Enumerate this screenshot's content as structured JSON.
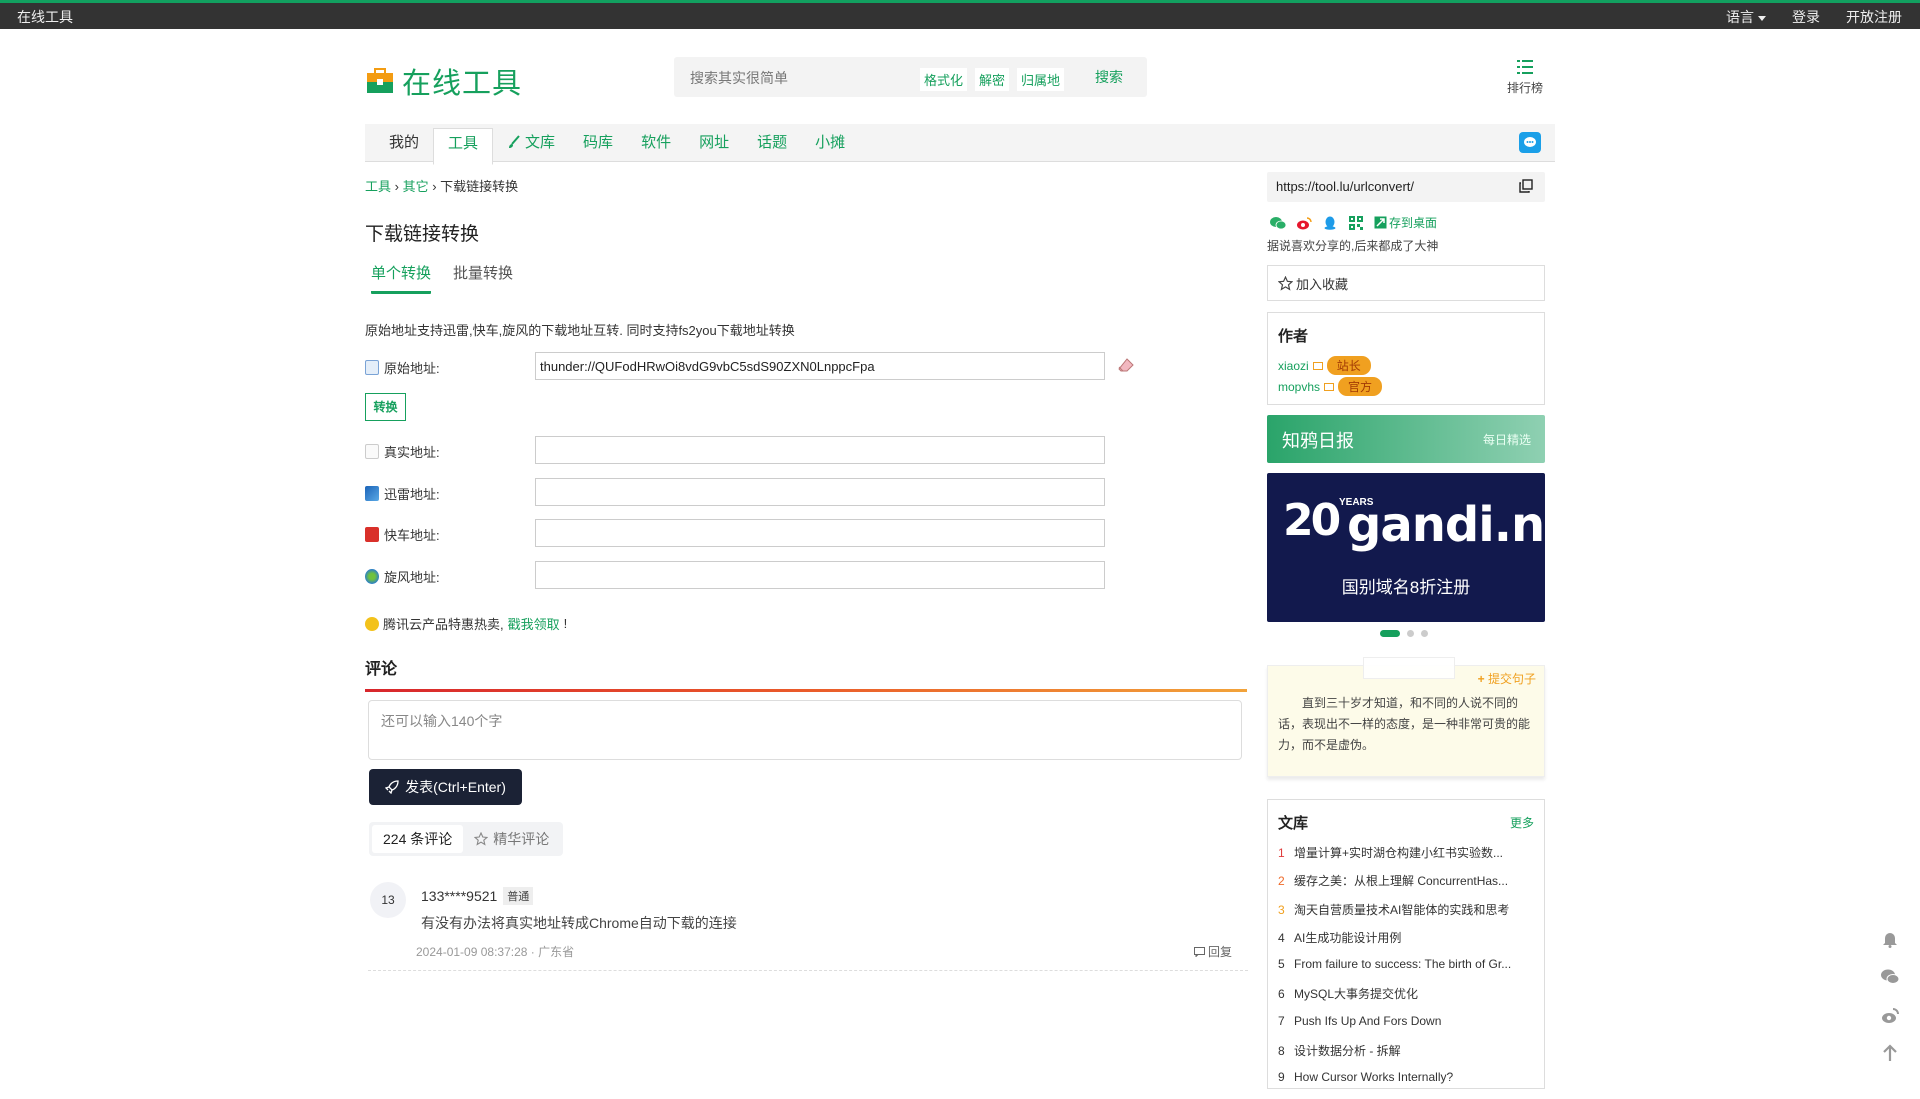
{
  "topbar": {
    "brand": "在线工具",
    "language": "语言",
    "login": "登录",
    "register": "开放注册"
  },
  "header": {
    "logo_text": "在线工具",
    "search_placeholder": "搜索其实很简单",
    "quick_tags": [
      "格式化",
      "解密",
      "归属地"
    ],
    "search_button": "搜索",
    "ranking": "排行榜"
  },
  "nav": {
    "items": [
      "我的",
      "工具",
      "文库",
      "码库",
      "软件",
      "网址",
      "话题",
      "小摊"
    ],
    "active": "工具"
  },
  "breadcrumb": {
    "level1": "工具",
    "level2": "其它",
    "current": "下载链接转换"
  },
  "page": {
    "title": "下载链接转换",
    "tabs": [
      "单个转换",
      "批量转换"
    ],
    "description": "原始地址支持迅雷,快车,旋风的下载地址互转. 同时支持fs2you下载地址转换",
    "fields": {
      "original_label": "原始地址:",
      "original_value": "thunder://QUFodHRwOi8vdG9vbC5sdS90ZXN0LnppcFpa",
      "real_label": "真实地址:",
      "thunder_label": "迅雷地址:",
      "flashget_label": "快车地址:",
      "qqxf_label": "旋风地址:"
    },
    "convert_button": "转换",
    "promo_text": "腾讯云产品特惠热卖,",
    "promo_link": "戳我领取",
    "promo_end": "!"
  },
  "comments": {
    "heading": "评论",
    "placeholder": "还可以输入140个字",
    "post_button": "发表(Ctrl+Enter)",
    "tab_all": "224 条评论",
    "tab_featured": "精华评论",
    "items": [
      {
        "avatar": "13",
        "user": "133****9521",
        "level": "普通",
        "text": "有没有办法将真实地址转成Chrome自动下载的连接",
        "meta": "2024-01-09 08:37:28 · 广东省",
        "reply": "回复"
      }
    ]
  },
  "sidebar": {
    "url": "https://tool.lu/urlconvert/",
    "save_desktop": "存到桌面",
    "share_note": "据说喜欢分享的,后来都成了大神",
    "favorite": "加入收藏",
    "author_heading": "作者",
    "authors": [
      {
        "name": "xiaozi",
        "badge": "站长"
      },
      {
        "name": "mopvhs",
        "badge": "官方"
      }
    ],
    "daily_title": "知鸦日报",
    "daily_sub": "每日精选",
    "ad_years": "20",
    "ad_years_label": "YEARS",
    "ad_brand": "gandi.net",
    "ad_sub": "国别域名8折注册",
    "quote_submit": "提交句子",
    "quote_text": "直到三十岁才知道，和不同的人说不同的话，表现出不一样的态度，是一种非常可贵的能力，而不是虚伪。",
    "library_heading": "文库",
    "library_more": "更多",
    "library_items": [
      "增量计算+实时湖仓构建小红书实验数...",
      "缓存之美：从根上理解 ConcurrentHas...",
      "淘天自营质量技术AI智能体的实践和思考",
      "AI生成功能设计用例",
      "From failure to success: The birth of Gr...",
      "MySQL大事务提交优化",
      "Push Ifs Up And Fors Down",
      "设计数据分析 - 拆解",
      "How Cursor Works Internally?"
    ]
  },
  "colors": {
    "accent": "#16a05d",
    "topbar": "#333333",
    "post_button": "#1b2235",
    "badge": "#f0a020"
  }
}
